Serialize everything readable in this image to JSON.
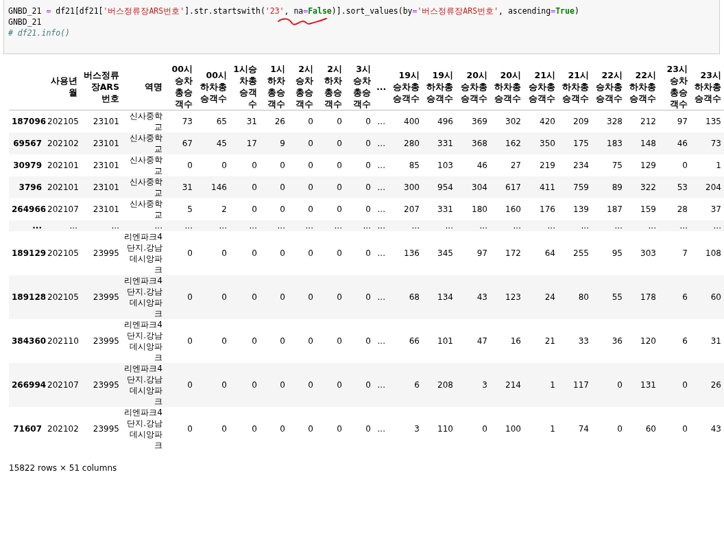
{
  "code_cell": {
    "lines": [
      [
        {
          "kind": "plain",
          "text": "GNBD_21 "
        },
        {
          "kind": "op",
          "text": "="
        },
        {
          "kind": "plain",
          "text": " df21[df21["
        },
        {
          "kind": "str",
          "text": "'버스정류장ARS번호'"
        },
        {
          "kind": "plain",
          "text": "].str.startswith("
        },
        {
          "kind": "str",
          "text": "'23'"
        },
        {
          "kind": "plain",
          "text": ", na"
        },
        {
          "kind": "op",
          "text": "="
        },
        {
          "kind": "kw",
          "text": "False"
        },
        {
          "kind": "plain",
          "text": ")].sort_values(by"
        },
        {
          "kind": "op",
          "text": "="
        },
        {
          "kind": "str",
          "text": "'버스정류장ARS번호'"
        },
        {
          "kind": "plain",
          "text": ", ascending"
        },
        {
          "kind": "op",
          "text": "="
        },
        {
          "kind": "kw",
          "text": "True"
        },
        {
          "kind": "plain",
          "text": ")"
        }
      ],
      [
        {
          "kind": "plain",
          "text": "GNBD_21"
        }
      ],
      [
        {
          "kind": "comment",
          "text": "# df21.info()"
        }
      ]
    ]
  },
  "table": {
    "columns": [
      "사용년월",
      "버스정류장ARS번호",
      "역명",
      "00시승차총승객수",
      "00시하차총승객수",
      "1시승차총승객수",
      "1시하차총승객수",
      "2시승차총승객수",
      "2시하차총승객수",
      "3시승차총승객수",
      "...",
      "19시승차총승객수",
      "19시하차총승객수",
      "20시승차총승객수",
      "20시하차총승객수",
      "21시승차총승객수",
      "21시하차총승객수",
      "22시승차총승객수",
      "22시하차총승객수",
      "23시승차총승객수",
      "23시하차총승객수"
    ],
    "rows": [
      {
        "index": "187096",
        "cells": [
          "202105",
          "23101",
          "신사중학교",
          "73",
          "65",
          "31",
          "26",
          "0",
          "0",
          "0",
          "...",
          "400",
          "496",
          "369",
          "302",
          "420",
          "209",
          "328",
          "212",
          "97",
          "135"
        ]
      },
      {
        "index": "69567",
        "cells": [
          "202102",
          "23101",
          "신사중학교",
          "67",
          "45",
          "17",
          "9",
          "0",
          "0",
          "0",
          "...",
          "280",
          "331",
          "368",
          "162",
          "350",
          "175",
          "183",
          "148",
          "46",
          "73"
        ]
      },
      {
        "index": "30979",
        "cells": [
          "202101",
          "23101",
          "신사중학교",
          "0",
          "0",
          "0",
          "0",
          "0",
          "0",
          "0",
          "...",
          "85",
          "103",
          "46",
          "27",
          "219",
          "234",
          "75",
          "129",
          "0",
          "1"
        ]
      },
      {
        "index": "3796",
        "cells": [
          "202101",
          "23101",
          "신사중학교",
          "31",
          "146",
          "0",
          "0",
          "0",
          "0",
          "0",
          "...",
          "300",
          "954",
          "304",
          "617",
          "411",
          "759",
          "89",
          "322",
          "53",
          "204"
        ]
      },
      {
        "index": "264966",
        "cells": [
          "202107",
          "23101",
          "신사중학교",
          "5",
          "2",
          "0",
          "0",
          "0",
          "0",
          "0",
          "...",
          "207",
          "331",
          "180",
          "160",
          "176",
          "139",
          "187",
          "159",
          "28",
          "37"
        ]
      },
      {
        "index": "...",
        "cells": [
          "...",
          "...",
          "...",
          "...",
          "...",
          "...",
          "...",
          "...",
          "...",
          "...",
          "...",
          "...",
          "...",
          "...",
          "...",
          "...",
          "...",
          "...",
          "...",
          "...",
          "..."
        ]
      },
      {
        "index": "189129",
        "cells": [
          "202105",
          "23995",
          "리엔파크4단지.강남데시앙파크",
          "0",
          "0",
          "0",
          "0",
          "0",
          "0",
          "0",
          "...",
          "136",
          "345",
          "97",
          "172",
          "64",
          "255",
          "95",
          "303",
          "7",
          "108"
        ]
      },
      {
        "index": "189128",
        "cells": [
          "202105",
          "23995",
          "리엔파크4단지.강남데시앙파크",
          "0",
          "0",
          "0",
          "0",
          "0",
          "0",
          "0",
          "...",
          "68",
          "134",
          "43",
          "123",
          "24",
          "80",
          "55",
          "178",
          "6",
          "60"
        ]
      },
      {
        "index": "384360",
        "cells": [
          "202110",
          "23995",
          "리엔파크4단지.강남데시앙파크",
          "0",
          "0",
          "0",
          "0",
          "0",
          "0",
          "0",
          "...",
          "66",
          "101",
          "47",
          "16",
          "21",
          "33",
          "36",
          "120",
          "6",
          "31"
        ]
      },
      {
        "index": "266994",
        "cells": [
          "202107",
          "23995",
          "리엔파크4단지.강남데시앙파크",
          "0",
          "0",
          "0",
          "0",
          "0",
          "0",
          "0",
          "...",
          "6",
          "208",
          "3",
          "214",
          "1",
          "117",
          "0",
          "131",
          "0",
          "26"
        ]
      },
      {
        "index": "71607",
        "cells": [
          "202102",
          "23995",
          "리엔파크4단지.강남데시앙파크",
          "0",
          "0",
          "0",
          "0",
          "0",
          "0",
          "0",
          "...",
          "3",
          "110",
          "0",
          "100",
          "1",
          "74",
          "0",
          "60",
          "0",
          "43"
        ]
      }
    ]
  },
  "footer": "15822 rows × 51 columns"
}
